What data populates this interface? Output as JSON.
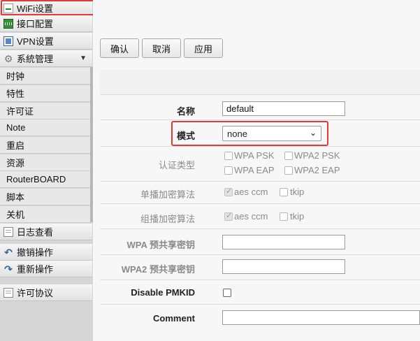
{
  "sidebar": {
    "top_items": [
      {
        "label": "WiFi设置",
        "icon": "wifi-icon"
      },
      {
        "label": "接口配置",
        "icon": "interface-icon"
      },
      {
        "label": "VPN设置",
        "icon": "vpn-icon"
      },
      {
        "label": "系統管理",
        "icon": "gear-icon",
        "expanded_caret": "▼"
      }
    ],
    "sub_items": [
      "时钟",
      "特性",
      "许可证",
      "Note",
      "重启",
      "资源",
      "RouterBOARD",
      "脚本",
      "关机"
    ],
    "bottom_items": [
      {
        "label": "日志查看",
        "icon": "log-icon"
      },
      {
        "label": "撤销操作",
        "icon": "undo-icon",
        "glyph": "↶"
      },
      {
        "label": "重新操作",
        "icon": "redo-icon",
        "glyph": "↷"
      },
      {
        "label": "许可协议",
        "icon": "license-icon"
      }
    ],
    "gear_glyph": "⚙"
  },
  "toolbar": {
    "confirm_label": "确认",
    "cancel_label": "取消",
    "apply_label": "应用"
  },
  "form": {
    "name_label": "名称",
    "name_value": "default",
    "mode_label": "模式",
    "mode_value": "none",
    "auth_label": "认证类型",
    "auth_options": [
      {
        "label": "WPA PSK",
        "checked": false
      },
      {
        "label": "WPA2 PSK",
        "checked": false
      },
      {
        "label": "WPA EAP",
        "checked": false
      },
      {
        "label": "WPA2 EAP",
        "checked": false
      }
    ],
    "unicast_label": "单播加密算法",
    "unicast_options": [
      {
        "label": "aes ccm",
        "checked": true
      },
      {
        "label": "tkip",
        "checked": false
      }
    ],
    "group_label": "组播加密算法",
    "group_options": [
      {
        "label": "aes ccm",
        "checked": true
      },
      {
        "label": "tkip",
        "checked": false
      }
    ],
    "wpa_psk_label": "WPA 预共享密钥",
    "wpa_psk_value": "",
    "wpa2_psk_label": "WPA2 预共享密钥",
    "wpa2_psk_value": "",
    "disable_pmkid_label": "Disable PMKID",
    "disable_pmkid_checked": false,
    "comment_label": "Comment",
    "comment_value": ""
  },
  "colors": {
    "highlight": "#e23a3a",
    "sidebar_bg": "#d6d6d6",
    "main_bg": "#f7f7f7"
  }
}
